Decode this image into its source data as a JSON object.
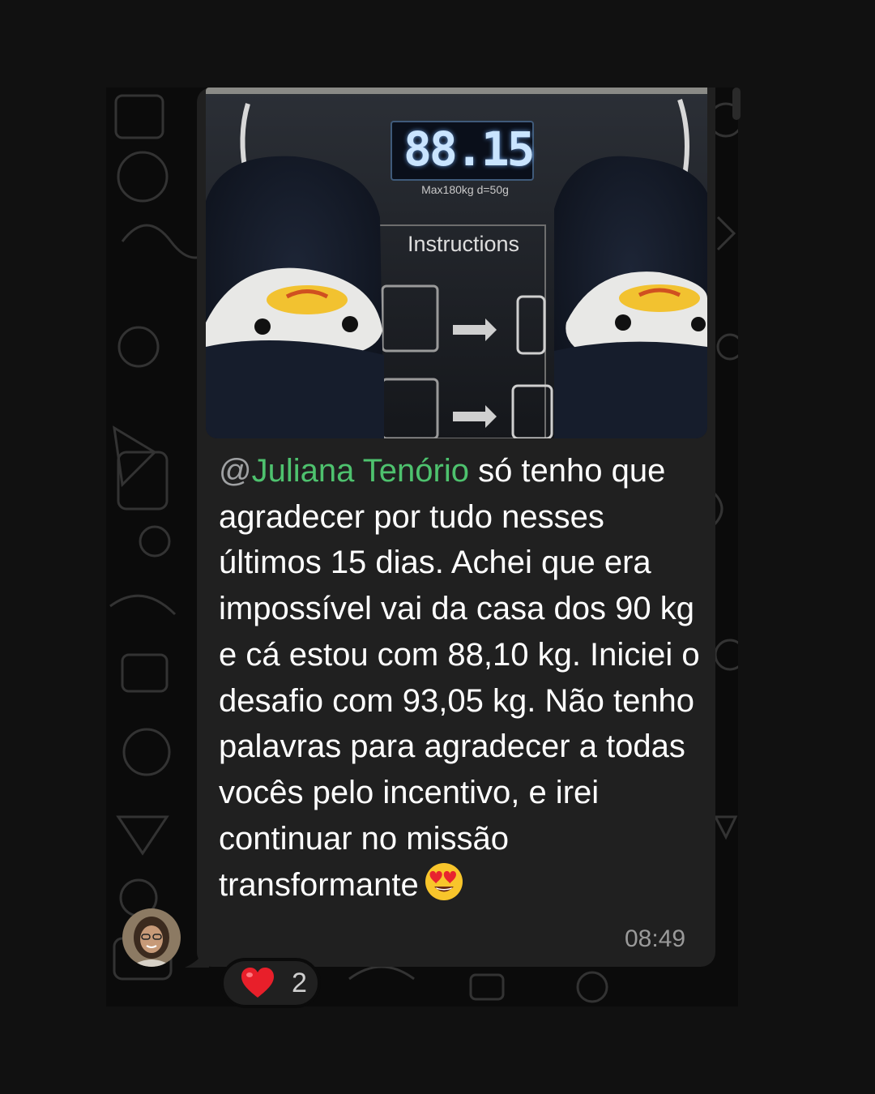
{
  "message": {
    "at_sign": "@",
    "mention": "Juliana Tenório",
    "text": " só tenho que agradecer por tudo nesses últimos 15 dias. Achei que era impossível vai da casa dos 90 kg e cá estou com 88,10 kg. Iniciei o desafio com 93,05 kg. Não tenho palavras para agradecer a todas vocês pelo incentivo, e irei continuar no missão transformante",
    "emoji": "smiling-face-with-heart-eyes-emoji",
    "time": "08:49"
  },
  "photo": {
    "scale_reading": "88.15",
    "scale_capacity": "Max180kg d=50g",
    "scale_panel_title": "Instructions"
  },
  "reaction": {
    "emoji": "red-heart-emoji",
    "count": "2"
  },
  "colors": {
    "background": "#111111",
    "bubble": "#202020",
    "mention": "#4ec26e",
    "timestamp": "#9a9a9a"
  }
}
